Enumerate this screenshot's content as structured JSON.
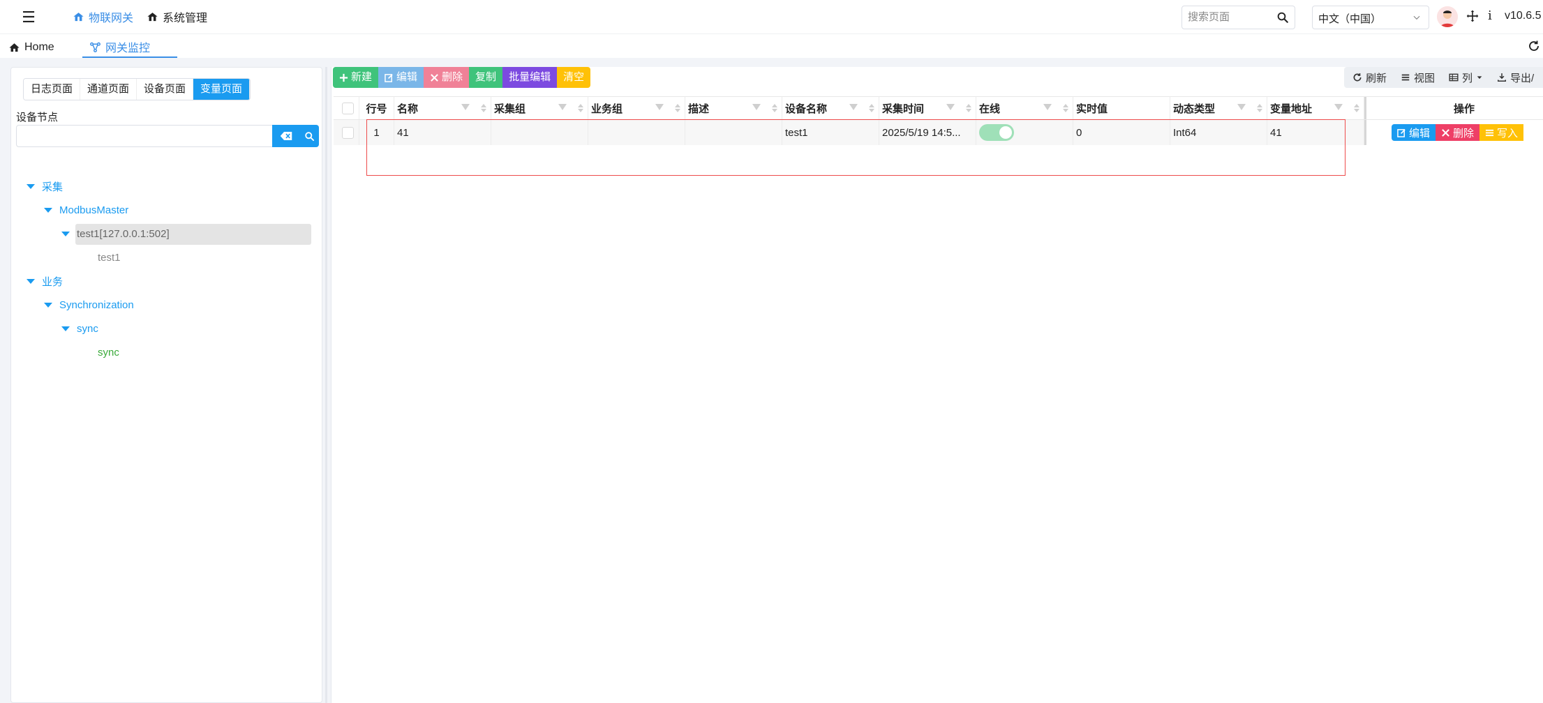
{
  "header": {
    "nav": [
      {
        "label": "物联网关",
        "active": true
      },
      {
        "label": "系统管理",
        "active": false
      }
    ],
    "search_placeholder": "搜索页面",
    "language": "中文（中国）",
    "version": "v10.6.5"
  },
  "tabs": [
    {
      "label": "Home"
    },
    {
      "label": "网关监控",
      "active": true
    }
  ],
  "left": {
    "pages": [
      "日志页面",
      "通道页面",
      "设备页面",
      "变量页面"
    ],
    "active_page": "变量页面",
    "node_label": "设备节点",
    "tree": [
      {
        "label": "采集",
        "level": 0
      },
      {
        "label": "ModbusMaster",
        "level": 1
      },
      {
        "label": "test1[127.0.0.1:502]",
        "level": 2
      },
      {
        "label": "test1",
        "level": 3
      },
      {
        "label": "业务",
        "level": 0
      },
      {
        "label": "Synchronization",
        "level": 1
      },
      {
        "label": "sync",
        "level": 2
      },
      {
        "label": "sync",
        "level": 3
      }
    ]
  },
  "toolbar": {
    "new": "新建",
    "edit": "编辑",
    "delete": "删除",
    "copy": "复制",
    "batch_edit": "批量编辑",
    "clear": "清空",
    "refresh": "刷新",
    "view": "视图",
    "columns": "列",
    "export": "导出/"
  },
  "table": {
    "headers": {
      "row_no": "行号",
      "name": "名称",
      "collect_group": "采集组",
      "business_group": "业务组",
      "desc": "描述",
      "device_name": "设备名称",
      "collect_time": "采集时间",
      "online": "在线",
      "realtime": "实时值",
      "dynamic_type": "动态类型",
      "address": "变量地址",
      "actions": "操作"
    },
    "rows": [
      {
        "row_no": "1",
        "name": "41",
        "collect_group": "",
        "business_group": "",
        "desc": "",
        "device_name": "test1",
        "collect_time": "2025/5/19 14:5...",
        "online": true,
        "realtime": "0",
        "dynamic_type": "Int64",
        "address": "41",
        "actions": {
          "edit": "编辑",
          "delete": "删除",
          "write": "写入"
        }
      }
    ]
  }
}
